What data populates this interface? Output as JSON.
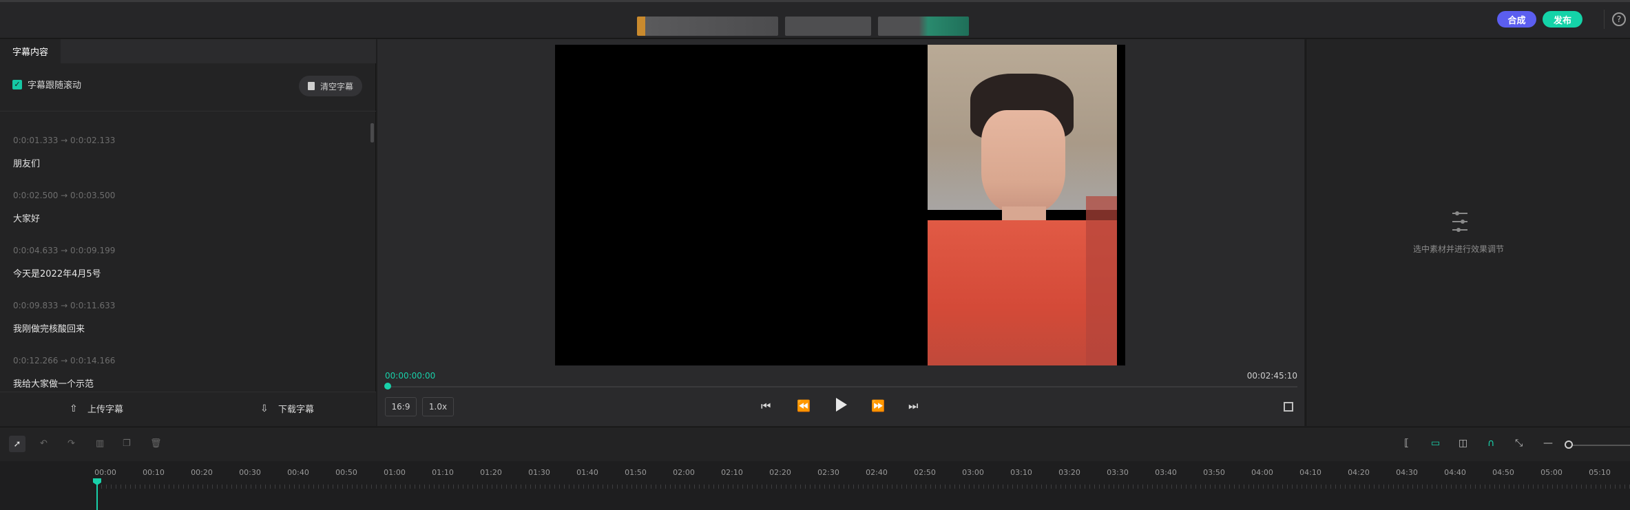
{
  "header": {
    "compose_label": "合成",
    "publish_label": "发布",
    "help_label": "?",
    "colors": {
      "compose": "#5b5ef0",
      "publish": "#14d3a8"
    }
  },
  "left_panel": {
    "tab_label": "字幕内容",
    "scroll_follow_label": "字幕跟随滚动",
    "clear_label": "清空字幕",
    "subtitles": [
      {
        "time": "0:0:01.333  →  0:0:02.133",
        "text": "朋友们"
      },
      {
        "time": "0:0:02.500  →  0:0:03.500",
        "text": "大家好"
      },
      {
        "time": "0:0:04.633  →  0:0:09.199",
        "text": "今天是2022年4月5号"
      },
      {
        "time": "0:0:09.833  →  0:0:11.633",
        "text": "我刚做完核酸回来"
      },
      {
        "time": "0:0:12.266  →  0:0:14.166",
        "text": "我给大家做一个示范"
      }
    ],
    "upload_label": "上传字幕",
    "download_label": "下载字幕"
  },
  "player": {
    "current_time": "00:00:00:00",
    "total_time": "00:02:45:10",
    "aspect_ratio": "16:9",
    "speed": "1.0x",
    "progress": 0
  },
  "right_panel": {
    "hint": "选中素材并进行效果调节"
  },
  "timeline": {
    "tick_labels": [
      "00:00",
      "00:10",
      "00:20",
      "00:30",
      "00:40",
      "00:50",
      "01:00",
      "01:10",
      "01:20",
      "01:30",
      "01:40",
      "01:50",
      "02:00",
      "02:10",
      "02:20",
      "02:30",
      "02:40",
      "02:50",
      "03:00",
      "03:10",
      "03:20",
      "03:30",
      "03:40",
      "03:50",
      "04:00",
      "04:10",
      "04:20",
      "04:30",
      "04:40",
      "04:50",
      "05:00",
      "05:10"
    ]
  }
}
